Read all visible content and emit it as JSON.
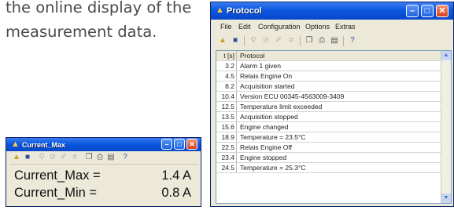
{
  "document": {
    "line1": "the online display of the",
    "line2": "measurement data."
  },
  "protocol_window": {
    "title": "Protocol",
    "menu": [
      "File",
      "Edit",
      "Configuration",
      "Options",
      "Extras"
    ],
    "header": {
      "time": "t [s]",
      "message": "Protocol"
    },
    "rows": [
      {
        "t": "3.2",
        "msg": "Alarm 1 given"
      },
      {
        "t": "4.5",
        "msg": "Relais Engine On"
      },
      {
        "t": "8.2",
        "msg": "Acquisition started"
      },
      {
        "t": "10.4",
        "msg": "Version ECU 00345-4563009-3409"
      },
      {
        "t": "12.5",
        "msg": "Temperature limit exceeded"
      },
      {
        "t": "13.5",
        "msg": "Acquisition stopped"
      },
      {
        "t": "15.6",
        "msg": "Engine changed"
      },
      {
        "t": "18.9",
        "msg": "Temperature = 23.5°C"
      },
      {
        "t": "22.5",
        "msg": "Relais Engine Off"
      },
      {
        "t": "23.4",
        "msg": "Engine stopped"
      },
      {
        "t": "24.5",
        "msg": "Temperature = 25.3°C"
      }
    ]
  },
  "current_window": {
    "title": "Current_Max",
    "max_label": "Current_Max =",
    "max_value": "1.4 A",
    "min_label": "Current_Min =",
    "min_value": "0.8 A"
  },
  "icons": [
    "app-icon",
    "open-icon",
    "save-icon",
    "zoom-icon",
    "clear-icon",
    "pen-icon",
    "grid-icon",
    "copy-icon",
    "print-icon",
    "paste-icon",
    "help-icon",
    "minimize-icon",
    "maximize-icon",
    "close-icon"
  ]
}
